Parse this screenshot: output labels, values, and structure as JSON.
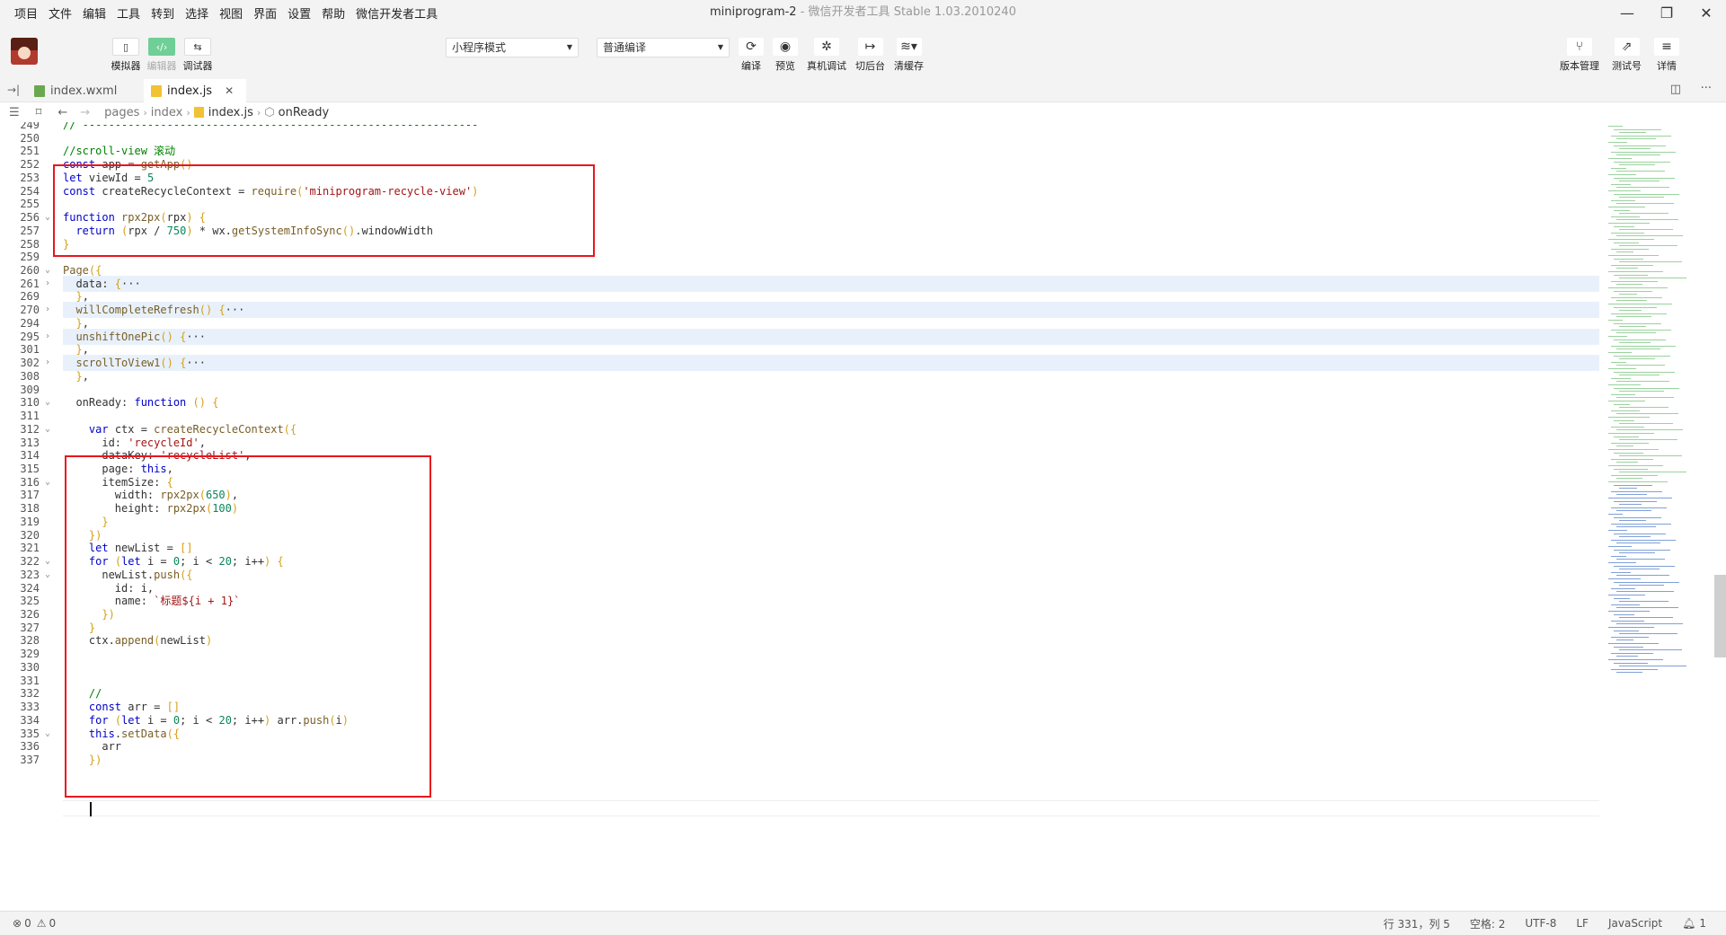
{
  "menu": [
    "项目",
    "文件",
    "编辑",
    "工具",
    "转到",
    "选择",
    "视图",
    "界面",
    "设置",
    "帮助",
    "微信开发者工具"
  ],
  "window": {
    "title": "miniprogram-2",
    "subtitle": "- 微信开发者工具 Stable 1.03.2010240",
    "minimize": "—",
    "maximize": "❐",
    "close": "✕"
  },
  "toolbar": {
    "simulator": "模拟器",
    "editor": "编辑器",
    "debugger": "调试器",
    "mode_select": "小程序模式",
    "compile_select": "普通编译",
    "compile": "编译",
    "preview": "预览",
    "real_debug": "真机调试",
    "background": "切后台",
    "clear_cache": "清缓存",
    "version_mgmt": "版本管理",
    "test_number": "测试号",
    "details": "详情"
  },
  "tabs": [
    {
      "label": "index.wxml",
      "color": "#6aa84f"
    },
    {
      "label": "index.js",
      "color": "#f1c232"
    }
  ],
  "breadcrumb": {
    "p1": "pages",
    "p2": "index",
    "p3": "index.js",
    "p4": "onReady"
  },
  "status": {
    "errors": "0",
    "warnings": "0",
    "position": "行 331，列 5",
    "spaces": "空格: 2",
    "encoding": "UTF-8",
    "eol": "LF",
    "language": "JavaScript",
    "notifications": "1"
  },
  "code_lines": [
    {
      "n": "249",
      "t": "// -------------------------------------------------------------"
    },
    {
      "n": "250",
      "t": ""
    },
    {
      "n": "251",
      "t": "//scroll-view 滚动"
    },
    {
      "n": "252",
      "t": "const app = getApp()"
    },
    {
      "n": "253",
      "t": "let viewId = 5"
    },
    {
      "n": "254",
      "t": "const createRecycleContext = require('miniprogram-recycle-view')"
    },
    {
      "n": "255",
      "t": ""
    },
    {
      "n": "256",
      "t": "function rpx2px(rpx) {",
      "fold": "v"
    },
    {
      "n": "257",
      "t": "  return (rpx / 750) * wx.getSystemInfoSync().windowWidth"
    },
    {
      "n": "258",
      "t": "}"
    },
    {
      "n": "259",
      "t": ""
    },
    {
      "n": "260",
      "t": "Page({",
      "fold": "v"
    },
    {
      "n": "261",
      "t": "  data: {···",
      "fold": ">",
      "folded": true
    },
    {
      "n": "269",
      "t": "  },"
    },
    {
      "n": "270",
      "t": "  willCompleteRefresh() {···",
      "fold": ">",
      "folded": true
    },
    {
      "n": "294",
      "t": "  },"
    },
    {
      "n": "295",
      "t": "  unshiftOnePic() {···",
      "fold": ">",
      "folded": true
    },
    {
      "n": "301",
      "t": "  },"
    },
    {
      "n": "302",
      "t": "  scrollToView1() {···",
      "fold": ">",
      "folded": true
    },
    {
      "n": "308",
      "t": "  },"
    },
    {
      "n": "309",
      "t": ""
    },
    {
      "n": "310",
      "t": "  onReady: function () {",
      "fold": "v"
    },
    {
      "n": "311",
      "t": ""
    },
    {
      "n": "312",
      "t": "    var ctx = createRecycleContext({",
      "fold": "v"
    },
    {
      "n": "313",
      "t": "      id: 'recycleId',"
    },
    {
      "n": "314",
      "t": "      dataKey: 'recycleList',"
    },
    {
      "n": "315",
      "t": "      page: this,"
    },
    {
      "n": "316",
      "t": "      itemSize: {",
      "fold": "v"
    },
    {
      "n": "317",
      "t": "        width: rpx2px(650),"
    },
    {
      "n": "318",
      "t": "        height: rpx2px(100)"
    },
    {
      "n": "319",
      "t": "      }"
    },
    {
      "n": "320",
      "t": "    })"
    },
    {
      "n": "321",
      "t": "    let newList = []"
    },
    {
      "n": "322",
      "t": "    for (let i = 0; i < 20; i++) {",
      "fold": "v"
    },
    {
      "n": "323",
      "t": "      newList.push({",
      "fold": "v"
    },
    {
      "n": "324",
      "t": "        id: i,"
    },
    {
      "n": "325",
      "t": "        name: `标题${i + 1}`"
    },
    {
      "n": "326",
      "t": "      })"
    },
    {
      "n": "327",
      "t": "    }"
    },
    {
      "n": "328",
      "t": "    ctx.append(newList)"
    },
    {
      "n": "329",
      "t": ""
    },
    {
      "n": "330",
      "t": ""
    },
    {
      "n": "331",
      "t": ""
    },
    {
      "n": "332",
      "t": "    //"
    },
    {
      "n": "333",
      "t": "    const arr = []"
    },
    {
      "n": "334",
      "t": "    for (let i = 0; i < 20; i++) arr.push(i)"
    },
    {
      "n": "335",
      "t": "    this.setData({",
      "fold": "v"
    },
    {
      "n": "336",
      "t": "      arr"
    },
    {
      "n": "337",
      "t": "    })"
    }
  ]
}
